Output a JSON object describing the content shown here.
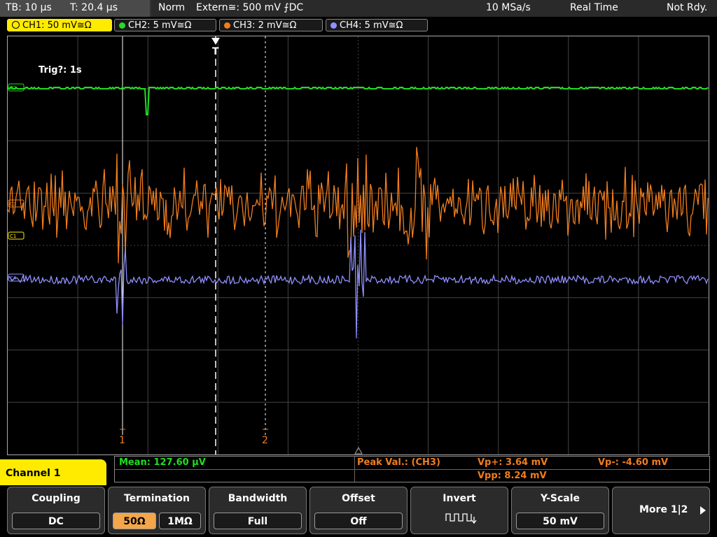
{
  "topbar": {
    "timebase": "TB: 10 µs",
    "trigger_time": "T: 20.4 µs",
    "mode": "Norm",
    "trigger_source": "Extern≅: 500 mV ⨍DC",
    "sample_rate": "10 MSa/s",
    "acq_mode": "Real Time",
    "status": "Not Rdy."
  },
  "channels": [
    {
      "label": "CH1: 50 mV≅Ω",
      "color": "#ffeb00",
      "active": true
    },
    {
      "label": "CH2: 5 mV≅Ω",
      "color": "#22dd22",
      "active": false
    },
    {
      "label": "CH3: 2 mV≅Ω",
      "color": "#f07d1e",
      "active": false
    },
    {
      "label": "CH4: 5 mV≅Ω",
      "color": "#8f8fff",
      "active": false
    }
  ],
  "grid": {
    "trigger_info": "Trig?: 1s",
    "trigger_marker": "T",
    "cursor1_label": "1",
    "cursor2_label": "2",
    "ch2_marker": "C2",
    "ch3_marker": "C3",
    "ch1_marker": "C1",
    "ch4_marker": "C4"
  },
  "measurements": {
    "mean": "Mean: 127.60 µV",
    "peak_label": "Peak Val.:  (CH3)",
    "vp_plus": "Vp+: 3.64 mV",
    "vp_minus": "Vp-: -4.60 mV",
    "vpp": "Vpp: 8.24 mV"
  },
  "channel_menu": {
    "title": "Channel 1"
  },
  "softkeys": {
    "coupling": {
      "title": "Coupling",
      "value": "DC"
    },
    "termination": {
      "title": "Termination",
      "opt1": "50Ω",
      "opt2": "1MΩ"
    },
    "bandwidth": {
      "title": "Bandwidth",
      "value": "Full"
    },
    "offset": {
      "title": "Offset",
      "value": "Off"
    },
    "invert": {
      "title": "Invert"
    },
    "yscale": {
      "title": "Y-Scale",
      "value": "50 mV"
    },
    "more": {
      "label": "More 1|2"
    }
  },
  "colors": {
    "ch1": "#ffeb00",
    "ch2": "#22dd22",
    "ch3": "#f07d1e",
    "ch4": "#8f8fff",
    "measure_green": "#22dd22",
    "measure_orange": "#f07d1e"
  }
}
